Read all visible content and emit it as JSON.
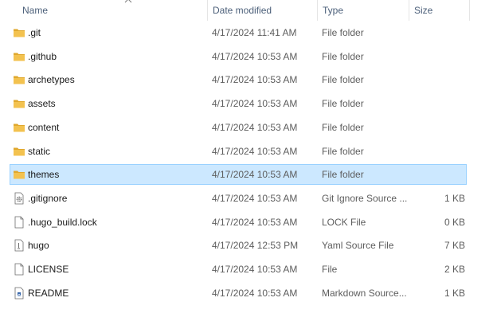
{
  "columns": {
    "name": "Name",
    "date": "Date modified",
    "type": "Type",
    "size": "Size"
  },
  "colors": {
    "folder": "#f3c24f",
    "folder_dark": "#e0a82e",
    "selected_bg": "#cce8ff",
    "selected_border": "#99d1ff",
    "header_text": "#4c607a"
  },
  "files": [
    {
      "name": ".git",
      "date": "4/17/2024 11:41 AM",
      "type": "File folder",
      "size": "",
      "icon": "folder-icon",
      "selected": false
    },
    {
      "name": ".github",
      "date": "4/17/2024 10:53 AM",
      "type": "File folder",
      "size": "",
      "icon": "folder-icon",
      "selected": false
    },
    {
      "name": "archetypes",
      "date": "4/17/2024 10:53 AM",
      "type": "File folder",
      "size": "",
      "icon": "folder-icon",
      "selected": false
    },
    {
      "name": "assets",
      "date": "4/17/2024 10:53 AM",
      "type": "File folder",
      "size": "",
      "icon": "folder-icon",
      "selected": false
    },
    {
      "name": "content",
      "date": "4/17/2024 10:53 AM",
      "type": "File folder",
      "size": "",
      "icon": "folder-icon",
      "selected": false
    },
    {
      "name": "static",
      "date": "4/17/2024 10:53 AM",
      "type": "File folder",
      "size": "",
      "icon": "folder-icon",
      "selected": false
    },
    {
      "name": "themes",
      "date": "4/17/2024 10:53 AM",
      "type": "File folder",
      "size": "",
      "icon": "folder-icon",
      "selected": true
    },
    {
      "name": ".gitignore",
      "date": "4/17/2024 10:53 AM",
      "type": "Git Ignore Source ...",
      "size": "1 KB",
      "icon": "gear-file-icon",
      "selected": false
    },
    {
      "name": ".hugo_build.lock",
      "date": "4/17/2024 10:53 AM",
      "type": "LOCK File",
      "size": "0 KB",
      "icon": "blank-file-icon",
      "selected": false
    },
    {
      "name": "hugo",
      "date": "4/17/2024 12:53 PM",
      "type": "Yaml Source File",
      "size": "7 KB",
      "icon": "text-file-icon",
      "selected": false
    },
    {
      "name": "LICENSE",
      "date": "4/17/2024 10:53 AM",
      "type": "File",
      "size": "2 KB",
      "icon": "blank-file-icon",
      "selected": false
    },
    {
      "name": "README",
      "date": "4/17/2024 10:53 AM",
      "type": "Markdown Source...",
      "size": "1 KB",
      "icon": "markdown-file-icon",
      "selected": false
    }
  ]
}
